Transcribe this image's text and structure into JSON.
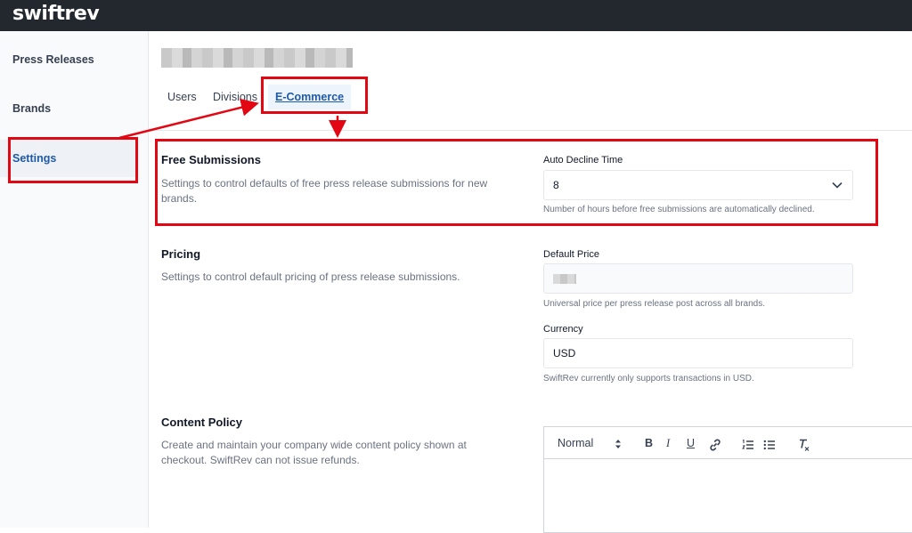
{
  "app": {
    "logo": "swiftrev"
  },
  "sidebar": {
    "items": [
      {
        "label": "Press Releases",
        "active": false
      },
      {
        "label": "Brands",
        "active": false
      },
      {
        "label": "Settings",
        "active": true
      }
    ]
  },
  "tabs": [
    {
      "label": "Users",
      "active": false
    },
    {
      "label": "Divisions",
      "active": false
    },
    {
      "label": "E-Commerce",
      "active": true
    }
  ],
  "sections": {
    "free_submissions": {
      "title": "Free Submissions",
      "description": "Settings to control defaults of free press release submissions for new brands.",
      "field_label": "Auto Decline Time",
      "field_value": "8",
      "help": "Number of hours before free submissions are automatically declined."
    },
    "pricing": {
      "title": "Pricing",
      "description": "Settings to control default pricing of press release submissions.",
      "price_label": "Default Price",
      "price_help": "Universal price per press release post across all brands.",
      "currency_label": "Currency",
      "currency_value": "USD",
      "currency_help": "SwiftRev currently only supports transactions in USD."
    },
    "content_policy": {
      "title": "Content Policy",
      "description": "Create and maintain your company wide content policy shown at checkout. SwiftRev can not issue refunds.",
      "editor": {
        "format": "Normal",
        "bold": "B",
        "italic": "I",
        "underline": "U"
      }
    }
  },
  "colors": {
    "topbar": "#23272e",
    "accent": "#1e5aa8",
    "highlight": "#e30613"
  }
}
